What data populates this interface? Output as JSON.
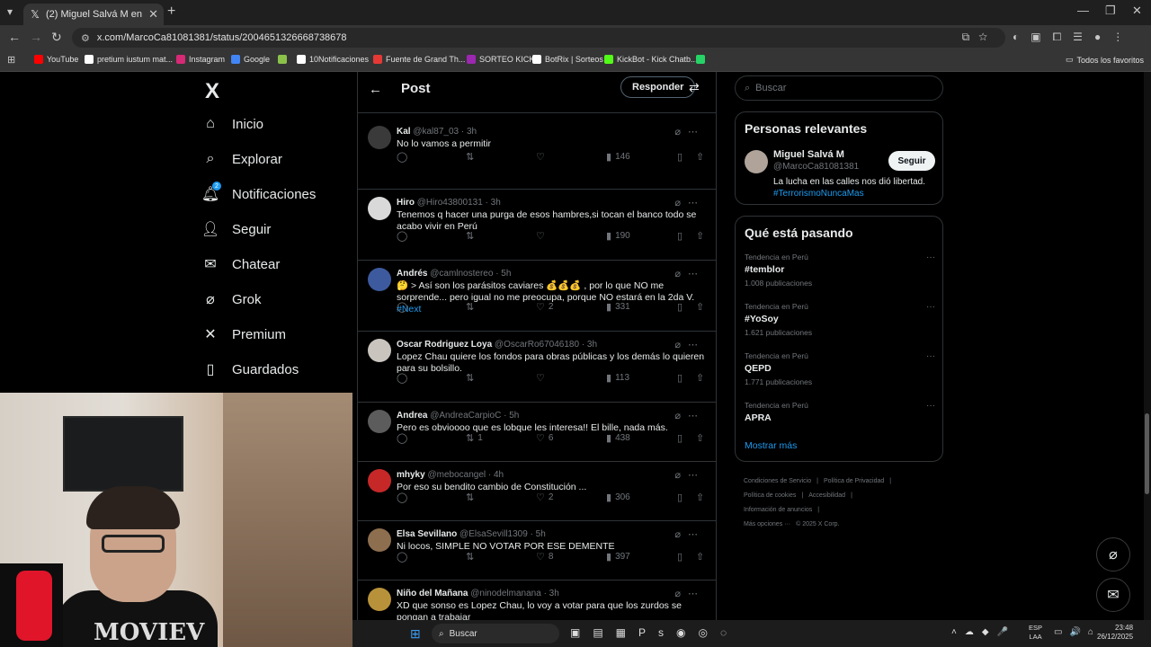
{
  "browser": {
    "tab_title": "(2) Miguel Salvá M en X: \"",
    "tab_close": "✕",
    "new_tab": "+",
    "url": "x.com/MarcoCa81081381/status/2004651326668738678",
    "bookmarks": [
      {
        "label": "YouTube",
        "color": "#ff0000"
      },
      {
        "label": "pretium iustum mat...",
        "color": "#ffffff"
      },
      {
        "label": "Instagram",
        "color": "#d62976"
      },
      {
        "label": "Google",
        "color": "#4285f4"
      },
      {
        "label": "",
        "color": "#8bc34a"
      },
      {
        "label": "10Notificaciones",
        "color": "#ffffff"
      },
      {
        "label": "Fuente de Grand Th...",
        "color": "#e53935"
      },
      {
        "label": "SORTEO KICK",
        "color": "#9c27b0"
      },
      {
        "label": "BotRix | Sorteos",
        "color": "#ffffff"
      },
      {
        "label": "KickBot - Kick Chatb...",
        "color": "#53fc18"
      },
      {
        "label": "",
        "color": "#25d366"
      }
    ],
    "all_bookmarks": "Todos los favoritos"
  },
  "nav": {
    "logo": "X",
    "items": [
      {
        "label": "Inicio",
        "icon": "home-icon"
      },
      {
        "label": "Explorar",
        "icon": "search-icon"
      },
      {
        "label": "Notificaciones",
        "icon": "bell-icon",
        "badge": "2"
      },
      {
        "label": "Seguir",
        "icon": "follow-icon"
      },
      {
        "label": "Chatear",
        "icon": "mail-icon"
      },
      {
        "label": "Grok",
        "icon": "grok-icon"
      },
      {
        "label": "Premium",
        "icon": "x-icon"
      },
      {
        "label": "Guardados",
        "icon": "bookmark-icon"
      }
    ]
  },
  "webcam": {
    "shirt_text": "MOVIEV"
  },
  "main": {
    "title": "Post",
    "reply_label": "Responder",
    "tweets": [
      {
        "name": "Kal",
        "handle": "@kal87_03",
        "time": "· 3h",
        "text": "No lo vamos a permitir",
        "replies": "",
        "reposts": "",
        "likes": "",
        "views": "146",
        "avatar_color": "#3a3a3a"
      },
      {
        "name": "Hiro",
        "handle": "@Hiro43800131",
        "time": "· 3h",
        "text": "Tenemos q hacer una purga de esos hambres,si tocan el banco todo se acabo vivir en Perú",
        "replies": "",
        "reposts": "",
        "likes": "",
        "views": "190",
        "avatar_color": "#d9d9d9"
      },
      {
        "name": "Andrés",
        "handle": "@camlnostereo",
        "time": "· 5h",
        "text": "🤔 > Así son los parásitos caviares 💰💰💰 , por lo que NO me sorprende... pero igual no me preocupa, porque NO estará en la 2da V. ",
        "link": "#Next",
        "replies": "",
        "reposts": "",
        "likes": "2",
        "views": "331",
        "avatar_color": "#3d5a9e"
      },
      {
        "name": "Oscar Rodriguez Loya",
        "handle": "@OscarRo67046180",
        "time": "· 3h",
        "text": "Lopez Chau quiere los fondos para obras públicas y los demás lo quieren para su bolsillo.",
        "replies": "",
        "reposts": "",
        "likes": "",
        "views": "113",
        "avatar_color": "#c9c4be"
      },
      {
        "name": "Andrea",
        "handle": "@AndreaCarpioC",
        "time": "· 5h",
        "text": "Pero es obvioooo que es lobque les interesa!! El bille, nada más.",
        "replies": "",
        "reposts": "1",
        "likes": "6",
        "views": "438",
        "avatar_color": "#5c5c5c"
      },
      {
        "name": "mhyky",
        "handle": "@mebocangel",
        "time": "· 4h",
        "text": "Por eso su bendito cambio de Constitución ...",
        "replies": "",
        "reposts": "",
        "likes": "2",
        "views": "306",
        "avatar_color": "#c62828"
      },
      {
        "name": "Elsa Sevillano",
        "handle": "@ElsaSevill1309",
        "time": "· 5h",
        "text": "Ni locos, SIMPLE NO VOTAR POR ESE DEMENTE",
        "replies": "",
        "reposts": "",
        "likes": "8",
        "views": "397",
        "avatar_color": "#8d6e4e"
      },
      {
        "name": "Niño del Mañana",
        "handle": "@ninodelmanana",
        "time": "· 3h",
        "text": "XD que sonso es Lopez Chau, lo voy a votar para que los zurdos se pongan a trabajar",
        "replies": "",
        "reposts": "",
        "likes": "",
        "views": "",
        "avatar_color": "#b8923a"
      }
    ]
  },
  "right": {
    "search_placeholder": "Buscar",
    "relevant_title": "Personas relevantes",
    "relevant": {
      "name": "Miguel Salvá M",
      "handle": "@MarcoCa81081381",
      "follow_label": "Seguir",
      "bio": "La lucha en las calles nos dió libertad.",
      "bio_tag": "#TerrorismoNuncaMas"
    },
    "trending_title": "Qué está pasando",
    "trends": [
      {
        "context": "Tendencia en Perú",
        "name": "#temblor",
        "count": "1.008 publicaciones"
      },
      {
        "context": "Tendencia en Perú",
        "name": "#YoSoy",
        "count": "1.621 publicaciones"
      },
      {
        "context": "Tendencia en Perú",
        "name": "QEPD",
        "count": "1.771 publicaciones"
      },
      {
        "context": "Tendencia en Perú",
        "name": "APRA",
        "count": ""
      }
    ],
    "show_more": "Mostrar más",
    "footer": [
      "Condiciones de Servicio",
      "|",
      "Política de Privacidad",
      "|",
      "Política de cookies",
      "|",
      "Accesibilidad",
      "|",
      "Información de anuncios",
      "|",
      "Más opciones ···",
      "© 2025 X Corp."
    ]
  },
  "taskbar": {
    "search": "Buscar",
    "lang_1": "ESP",
    "lang_2": "LAA",
    "time": "23:48",
    "date": "26/12/2025"
  }
}
